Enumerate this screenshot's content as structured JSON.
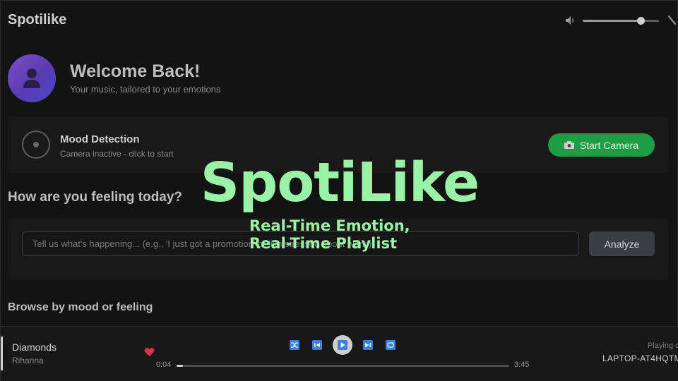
{
  "app": {
    "title": "Spotilike"
  },
  "volume": {
    "level": 0.76
  },
  "welcome": {
    "title": "Welcome Back!",
    "subtitle": "Your music, tailored to your emotions"
  },
  "mood": {
    "title": "Mood Detection",
    "status": "Camera inactive - click to start",
    "start_button": "Start Camera"
  },
  "feeling": {
    "title": "How are you feeling today?",
    "placeholder": "Tell us what's happening... (e.g., 'I just got a promotion' or 'I'm stressed about work')",
    "value": "",
    "analyze_button": "Analyze"
  },
  "browse": {
    "title": "Browse by mood or feeling"
  },
  "player": {
    "track_title": "Diamonds",
    "artist": "Rihanna",
    "current_time": "0:04",
    "total_time": "3:45",
    "progress": 0.02,
    "playing_on_label": "Playing o",
    "device": "LAPTOP-AT4HQTM"
  },
  "overlay": {
    "title": "SpotiLike",
    "subtitle_line1": "Real-Time Emotion,",
    "subtitle_line2": "Real-Time Playlist"
  },
  "colors": {
    "accent_green": "#1f9d45",
    "overlay_green": "#9af2a6",
    "control_blue": "#3f7fd6",
    "heart_red": "#e0304e"
  },
  "icons": [
    "volume-icon",
    "edit-icon",
    "user-icon",
    "camera-icon",
    "heart-icon",
    "shuffle-icon",
    "previous-icon",
    "play-icon",
    "next-icon",
    "repeat-icon"
  ]
}
